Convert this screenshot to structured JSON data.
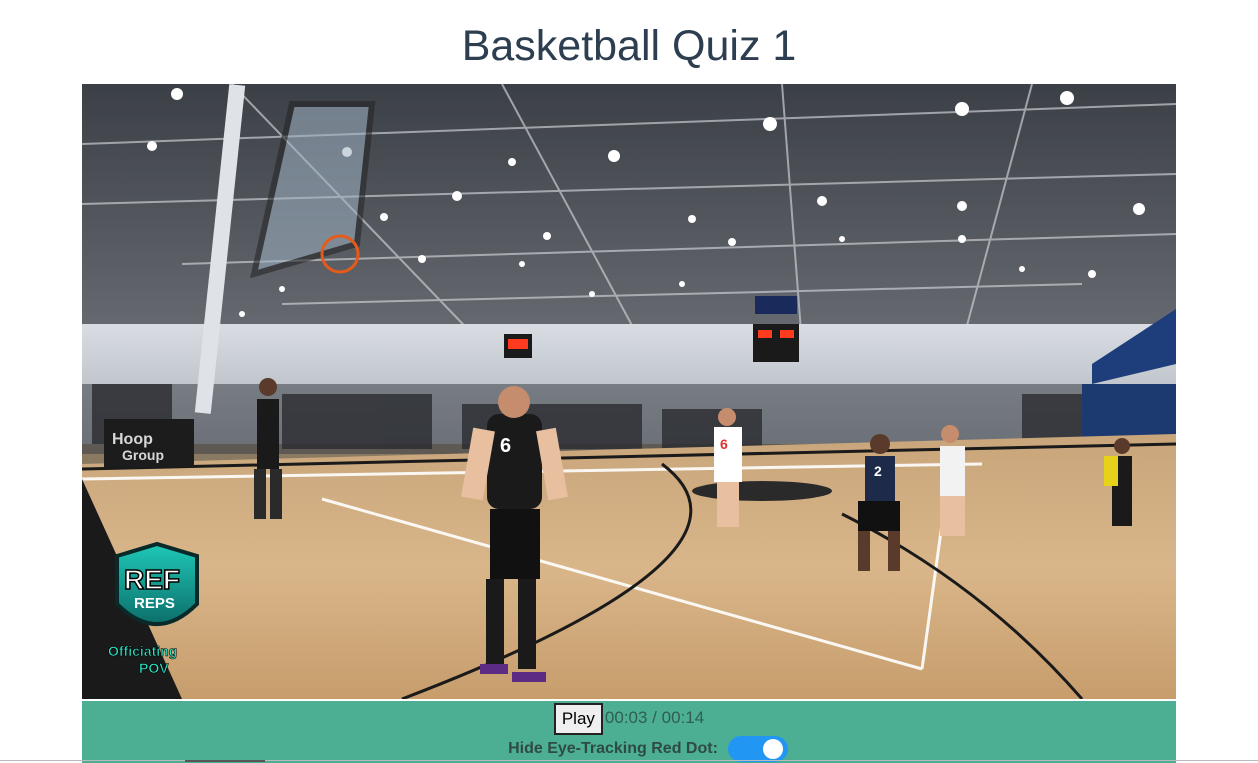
{
  "page": {
    "title": "Basketball Quiz 1"
  },
  "video": {
    "description_icon": "video-player",
    "logo_text_top": "REF",
    "logo_text_mid": "REPS",
    "logo_text_bottom_1": "Officiating",
    "logo_text_bottom_2": "POV"
  },
  "controls": {
    "play_label": "Play",
    "current_time": "00:03",
    "duration": "00:14",
    "time_display": "00:03 / 00:14",
    "toggle_label": "Hide Eye-Tracking Red Dot:",
    "toggle_on": true,
    "bar_color": "#4caf94",
    "toggle_color": "#2196f3"
  }
}
